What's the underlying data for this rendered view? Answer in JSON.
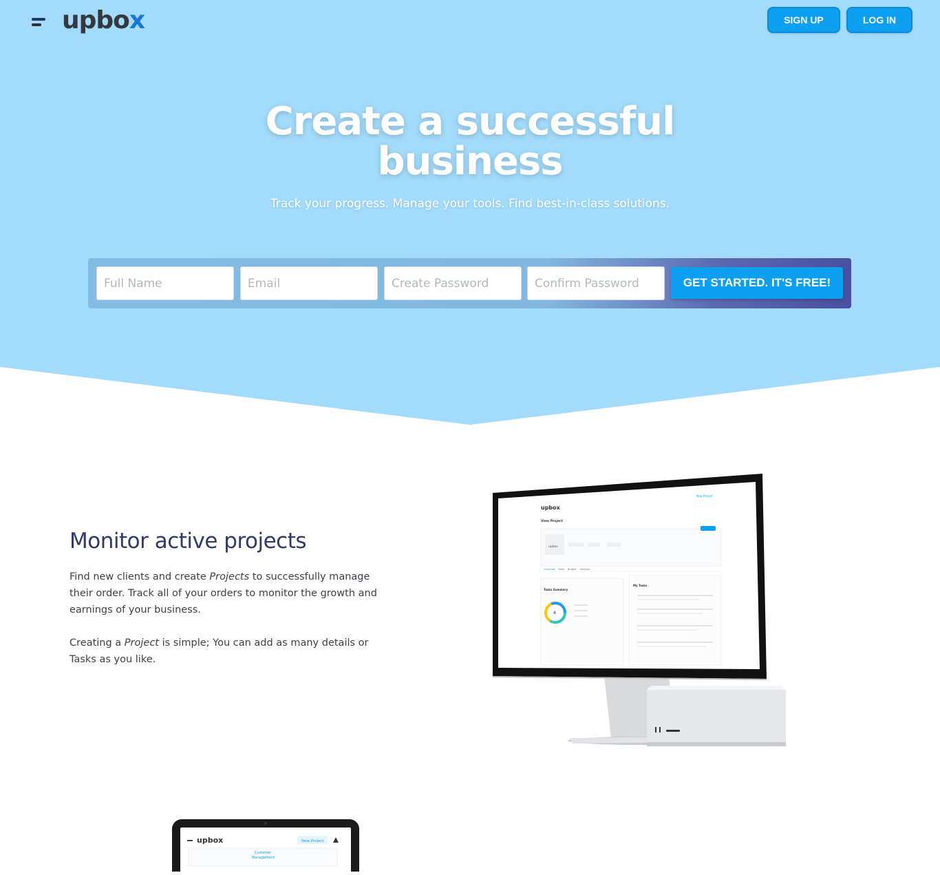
{
  "header": {
    "logo_main": "upbo",
    "logo_x": "x",
    "signup_label": "SIGN UP",
    "login_label": "LOG IN"
  },
  "hero": {
    "title_line1": "Create a successful",
    "title_line2": "business",
    "subtitle": "Track your progress. Manage your tools. Find best-in-class solutions."
  },
  "signup_form": {
    "full_name_placeholder": "Full Name",
    "email_placeholder": "Email",
    "password_placeholder": "Create Password",
    "confirm_placeholder": "Confirm Password",
    "cta_label": "GET STARTED. IT'S FREE!"
  },
  "feature": {
    "title": "Monitor active projects",
    "p1_a": "Find new clients and create ",
    "p1_em": "Projects",
    "p1_b": " to successfully manage their order. Track all of your orders to monitor the growth and earnings of your business.",
    "p2_a": "Creating a ",
    "p2_em": "Project",
    "p2_b": " is simple; You can add as many details or Tasks as you like."
  },
  "monitor_screen": {
    "logo": "upbox",
    "new_project": "New Project",
    "page_title": "View Project",
    "tasks_summary": "Tasks Summary",
    "my_tasks": "My Tasks",
    "donut_value": "4",
    "tabs": [
      "Overview",
      "Tasks",
      "Budget",
      "Settings"
    ]
  },
  "tablet_screen": {
    "logo": "upbox",
    "new_project": "New Project",
    "line1": "Customer",
    "line2": "Management"
  },
  "colors": {
    "hero_bg": "#a2dbfb",
    "accent": "#0d9ff0",
    "title_navy": "#2d3a6b"
  }
}
